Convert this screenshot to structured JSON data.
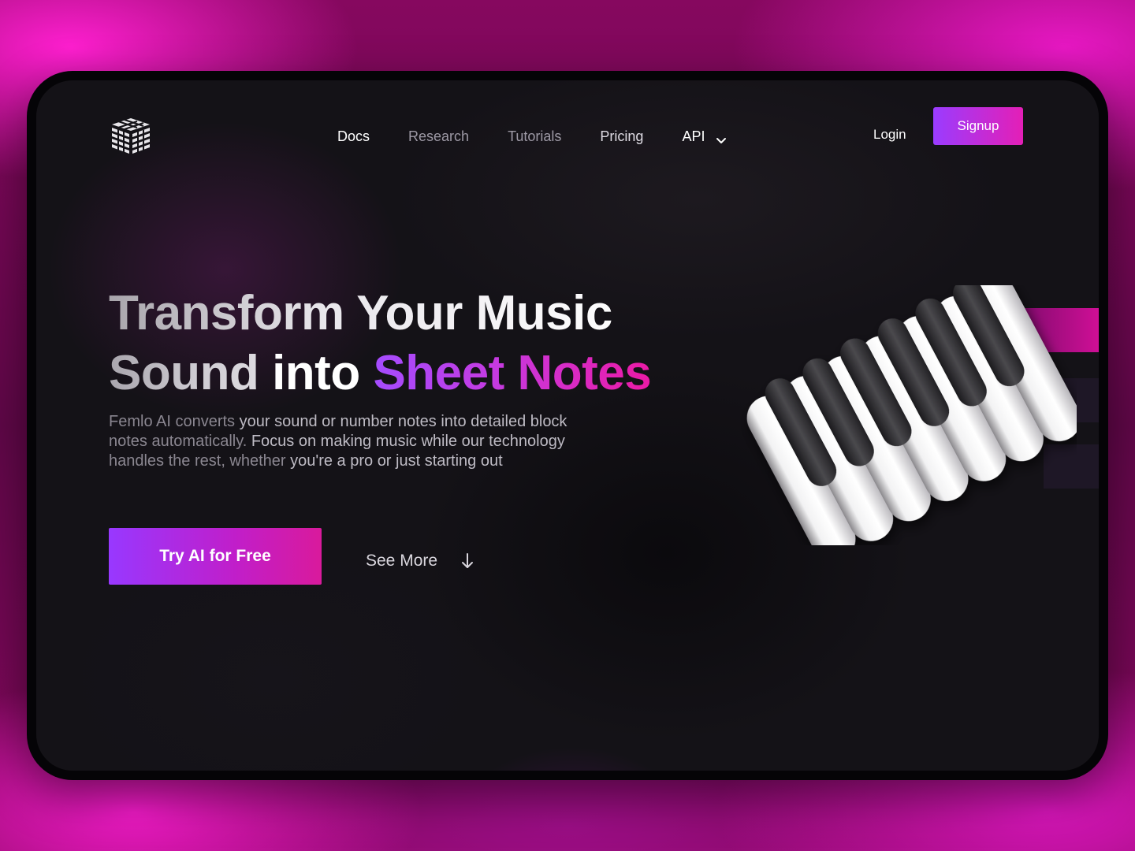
{
  "brand": {
    "logo_icon": "striped-cube-logo"
  },
  "nav": {
    "items": [
      {
        "label": "Docs"
      },
      {
        "label": "Research"
      },
      {
        "label": "Tutorials"
      },
      {
        "label": "Pricing"
      },
      {
        "label": "API",
        "icon": "chevron-down-icon"
      }
    ],
    "login_label": "Login",
    "signup_label": "Signup"
  },
  "hero": {
    "title_line1": "Transform Your Music",
    "title_line2_part1": "Sound",
    "title_line2_part2": "into",
    "title_line2_accent": "Sheet Notes",
    "description_part1": "Femlo AI converts ",
    "description_part2": "your sound or number notes into detailed block",
    "description_part3": "notes automatically. ",
    "description_part4": "Focus on making music while our technology",
    "description_part5": "handles the rest, whether ",
    "description_part6": "you're a pro or just starting out",
    "cta_primary_label": "Try AI for Free",
    "cta_secondary_label": "See More",
    "cta_secondary_icon": "arrow-down-icon"
  },
  "illustration": {
    "name": "3d-piano-keys"
  },
  "colors": {
    "accent_start": "#9a3cff",
    "accent_end": "#e41fb6",
    "background": "#141217",
    "frame_background": "#86085f"
  }
}
